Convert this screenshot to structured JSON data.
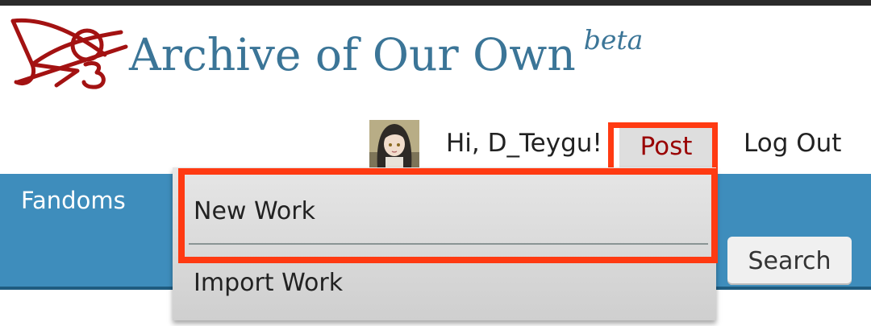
{
  "header": {
    "site_name": "Archive of Our Own",
    "beta_label": "beta",
    "logo_icon": "ao3-logo-icon"
  },
  "user_bar": {
    "greeting": "Hi, D_Teygu!",
    "post_label": "Post",
    "logout_label": "Log Out"
  },
  "nav": {
    "fandoms_label": "Fandoms",
    "search_label": "Search"
  },
  "post_menu": {
    "items": [
      {
        "label": "New Work"
      },
      {
        "label": "Import Work"
      }
    ]
  },
  "colors": {
    "title": "#3b7597",
    "nav_bar": "#3e8dbc",
    "post_text": "#990000",
    "highlight": "#ff3a12"
  }
}
